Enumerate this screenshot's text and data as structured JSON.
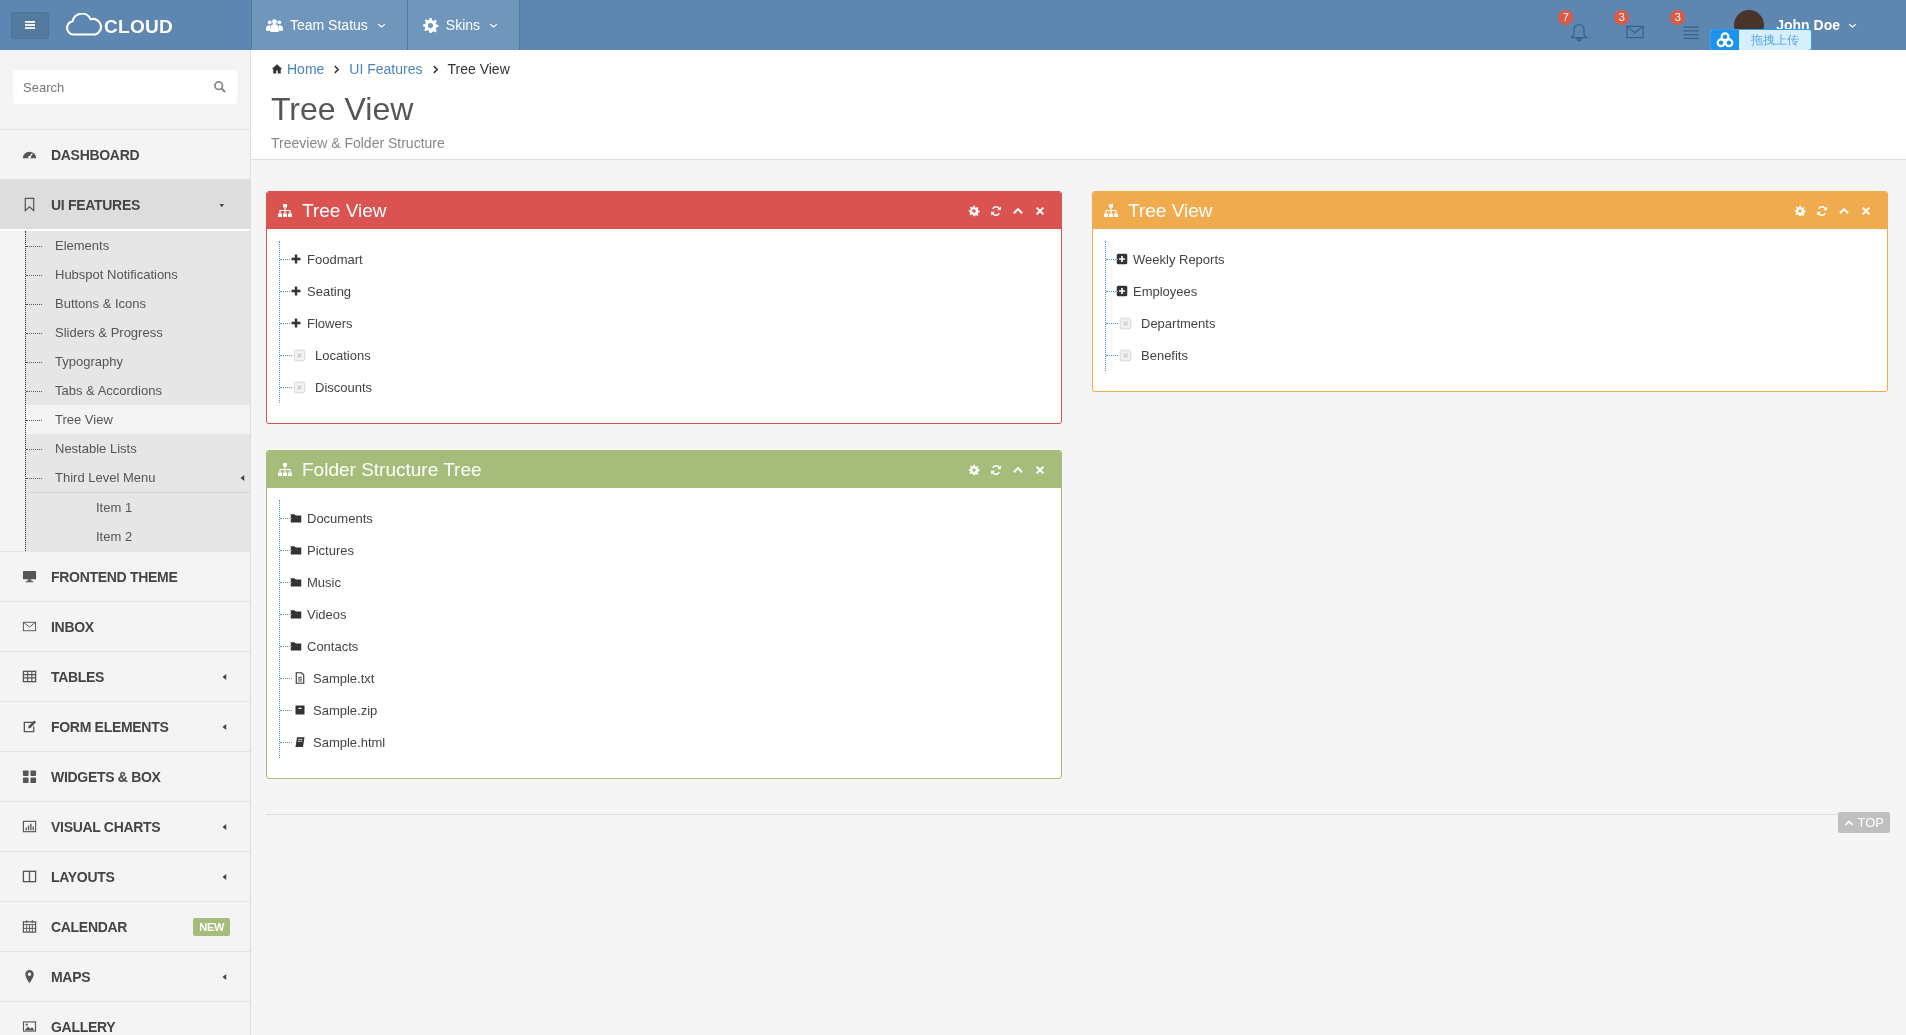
{
  "topbar": {
    "logo": "CLOUD",
    "nav": [
      {
        "kind": "team",
        "label": "Team Status"
      },
      {
        "kind": "gear",
        "label": "Skins"
      }
    ],
    "notifications": [
      {
        "kind": "bell",
        "count": "7"
      },
      {
        "kind": "mail",
        "count": "3"
      },
      {
        "kind": "tasks",
        "count": "3"
      }
    ],
    "user": {
      "name": "John Doe"
    },
    "upload": {
      "label": "拖拽上传"
    }
  },
  "sidebar": {
    "search": {
      "placeholder": "Search"
    },
    "items": [
      {
        "kind": "dashboard",
        "label": "DASHBOARD"
      },
      {
        "kind": "bookmark",
        "label": "UI FEATURES",
        "expanded": true,
        "children": [
          {
            "label": "Elements",
            "selected": false
          },
          {
            "label": "Hubspot Notifications",
            "selected": false
          },
          {
            "label": "Buttons & Icons",
            "selected": false
          },
          {
            "label": "Sliders & Progress",
            "selected": false
          },
          {
            "label": "Typography",
            "selected": false
          },
          {
            "label": "Tabs & Accordions",
            "selected": false
          },
          {
            "label": "Tree View",
            "selected": true
          },
          {
            "label": "Nestable Lists",
            "selected": false
          },
          {
            "label": "Third Level Menu",
            "selected": false,
            "children": [
              {
                "label": "Item 1"
              },
              {
                "label": "Item 2"
              }
            ]
          }
        ]
      },
      {
        "kind": "desktop",
        "label": "FRONTEND THEME"
      },
      {
        "kind": "envelope",
        "label": "INBOX"
      },
      {
        "kind": "table",
        "label": "TABLES",
        "expanded": false
      },
      {
        "kind": "edit",
        "label": "FORM ELEMENTS",
        "expanded": false
      },
      {
        "kind": "grid",
        "label": "WIDGETS & BOX"
      },
      {
        "kind": "chart",
        "label": "VISUAL CHARTS",
        "expanded": false
      },
      {
        "kind": "columns",
        "label": "LAYOUTS",
        "expanded": false
      },
      {
        "kind": "calendar",
        "label": "CALENDAR",
        "badge": "NEW"
      },
      {
        "kind": "marker",
        "label": "MAPS",
        "expanded": false
      },
      {
        "kind": "picture",
        "label": "GALLERY"
      }
    ]
  },
  "breadcrumb": [
    {
      "label": "Home",
      "link": true
    },
    {
      "label": "UI Features",
      "link": true
    },
    {
      "label": "Tree View",
      "link": false
    }
  ],
  "page": {
    "title": "Tree View",
    "subtitle": "Treeview & Folder Structure"
  },
  "columns": [
    [
      {
        "title": "Tree View",
        "color": "#da5350",
        "nodes": [
          {
            "kind": "plus",
            "label": "Foodmart"
          },
          {
            "kind": "plus",
            "label": "Seating"
          },
          {
            "kind": "plus",
            "label": "Flowers"
          },
          {
            "kind": "leaf",
            "label": "Locations"
          },
          {
            "kind": "leaf",
            "label": "Discounts"
          }
        ]
      },
      {
        "title": "Folder Structure Tree",
        "color": "#a5bc7a",
        "nodes": [
          {
            "kind": "folder",
            "label": "Documents"
          },
          {
            "kind": "folder",
            "label": "Pictures"
          },
          {
            "kind": "folder",
            "label": "Music"
          },
          {
            "kind": "folder",
            "label": "Videos"
          },
          {
            "kind": "folder",
            "label": "Contacts"
          },
          {
            "kind": "file-text",
            "label": "Sample.txt"
          },
          {
            "kind": "file-zip",
            "label": "Sample.zip"
          },
          {
            "kind": "file-html",
            "label": "Sample.html"
          }
        ]
      }
    ],
    [
      {
        "title": "Tree View",
        "color": "#efab4d",
        "nodes": [
          {
            "kind": "plus-square",
            "label": "Weekly Reports"
          },
          {
            "kind": "plus-square",
            "label": "Employees"
          },
          {
            "kind": "leaf",
            "label": "Departments"
          },
          {
            "kind": "leaf",
            "label": "Benefits"
          }
        ]
      }
    ]
  ],
  "back_to_top": {
    "label": "TOP"
  }
}
